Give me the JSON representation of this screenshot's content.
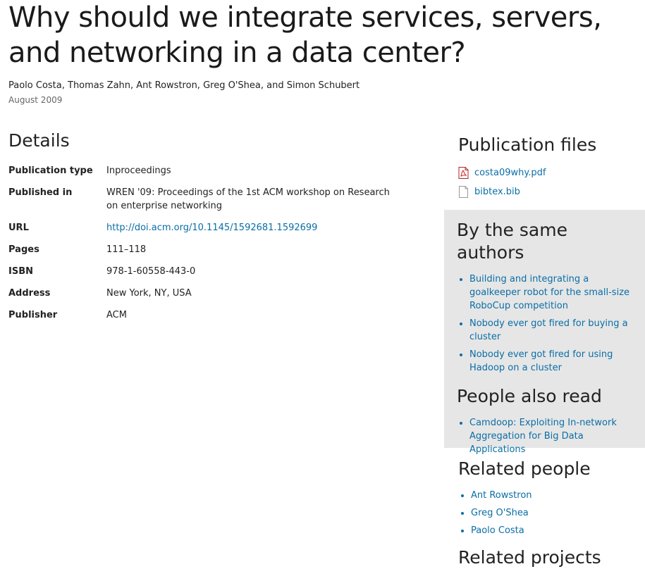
{
  "publication": {
    "title": "Why should we integrate services, servers, and networking in a data center?",
    "authors": "Paolo Costa, Thomas Zahn, Ant Rowstron, Greg O'Shea, and Simon Schubert",
    "date": "August 2009"
  },
  "details": {
    "heading": "Details",
    "rows": [
      {
        "label": "Publication type",
        "value": "Inproceedings"
      },
      {
        "label": "Published in",
        "value": "WREN '09: Proceedings of the 1st ACM workshop on Research on enterprise networking"
      },
      {
        "label": "URL",
        "value": "http://doi.acm.org/10.1145/1592681.1592699"
      },
      {
        "label": "Pages",
        "value": "111–118"
      },
      {
        "label": "ISBN",
        "value": "978-1-60558-443-0"
      },
      {
        "label": "Address",
        "value": "New York, NY, USA"
      },
      {
        "label": "Publisher",
        "value": "ACM"
      }
    ]
  },
  "files": {
    "heading": "Publication files",
    "items": [
      {
        "name": "costa09why.pdf",
        "icon": "pdf-file-icon"
      },
      {
        "name": "bibtex.bib",
        "icon": "document-file-icon"
      }
    ]
  },
  "same_authors": {
    "heading": "By the same authors",
    "items": [
      "Building and integrating a goalkeeper robot for the small-size RoboCup competition",
      "Nobody ever got fired for buying a cluster",
      "Nobody ever got fired for using Hadoop on a cluster"
    ]
  },
  "also_read": {
    "heading": "People also read",
    "items": [
      "Camdoop: Exploiting In-network Aggregation for Big Data Applications"
    ]
  },
  "related_people": {
    "heading": "Related people",
    "items": [
      "Ant Rowstron",
      "Greg O'Shea",
      "Paolo Costa"
    ]
  },
  "related_projects": {
    "heading": "Related projects"
  },
  "colors": {
    "link": "#0a6ea6",
    "sidebar_background": "#e6e6e6"
  }
}
